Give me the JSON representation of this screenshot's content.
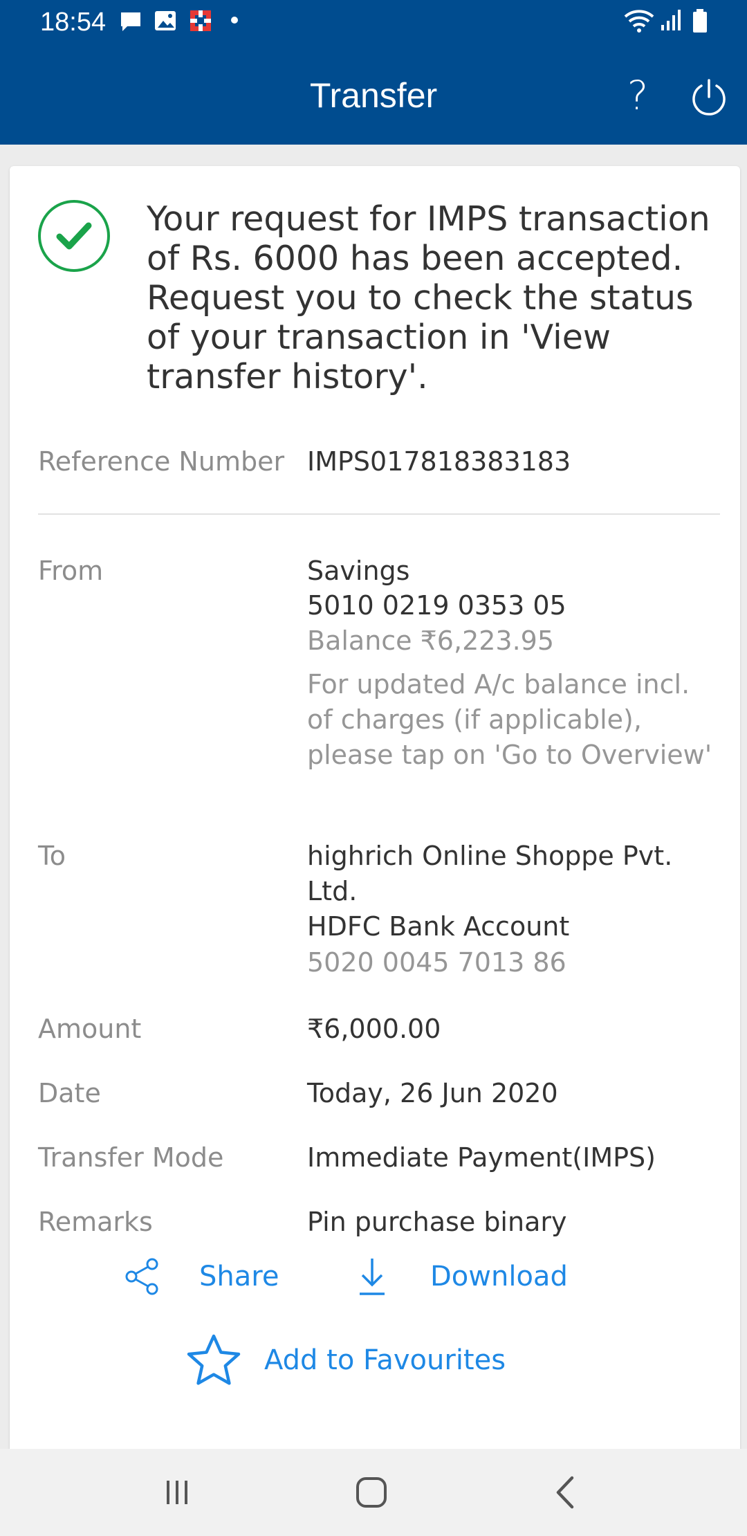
{
  "status_bar": {
    "time": "18:54",
    "icons": [
      "chat-icon",
      "image-icon",
      "hdfc-logo-icon",
      "dot-icon",
      "wifi-icon",
      "signal-icon",
      "battery-icon"
    ]
  },
  "header": {
    "title": "Transfer",
    "help_label": "?",
    "color": "#004c8f"
  },
  "confirmation": {
    "message": "Your request for IMPS transaction of Rs. 6000 has been accepted. Request you to check the status of your transaction in 'View transfer history'.",
    "icon": "success-check-icon",
    "icon_color": "#1aa34a"
  },
  "details": {
    "reference": {
      "label": "Reference Number",
      "value": "IMPS017818383183"
    },
    "from": {
      "label": "From",
      "account_type": "Savings",
      "account_number": "5010 0219 0353 05",
      "balance": "Balance ₹6,223.95",
      "note": "For updated A/c balance incl. of charges (if applicable), please tap on 'Go to Overview'"
    },
    "to": {
      "label": "To",
      "name": "highrich Online Shoppe Pvt. Ltd.",
      "bank": "HDFC Bank Account",
      "account_number": "5020 0045 7013 86"
    },
    "amount": {
      "label": "Amount",
      "value": "₹6,000.00"
    },
    "date": {
      "label": "Date",
      "value": "Today, 26 Jun 2020"
    },
    "mode": {
      "label": "Transfer Mode",
      "value": "Immediate Payment(IMPS)"
    },
    "remarks": {
      "label": "Remarks",
      "value": "Pin purchase binary"
    }
  },
  "actions": {
    "share": "Share",
    "download": "Download",
    "favourite": "Add to Favourites",
    "color": "#1e88e5"
  },
  "nav": [
    "recent-apps-icon",
    "home-icon",
    "back-icon"
  ]
}
